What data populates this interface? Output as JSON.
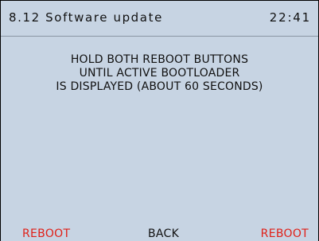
{
  "header": {
    "title": "8.12 Software update",
    "time": "22:41"
  },
  "message": {
    "lines": [
      "HOLD BOTH REBOOT BUTTONS",
      "UNTIL ACTIVE BOOTLOADER",
      "IS DISPLAYED (ABOUT 60 SECONDS)"
    ]
  },
  "softkeys": {
    "left": "REBOOT",
    "middle": "BACK",
    "right": "REBOOT"
  },
  "colors": {
    "background": "#c7d4e3",
    "text": "#111111",
    "reboot_label": "#e02018"
  }
}
